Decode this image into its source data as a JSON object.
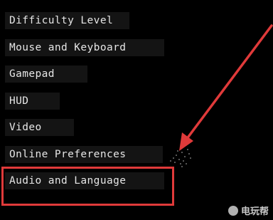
{
  "menu": {
    "items": [
      {
        "label": "Difficulty Level"
      },
      {
        "label": "Mouse and Keyboard"
      },
      {
        "label": "Gamepad"
      },
      {
        "label": "HUD"
      },
      {
        "label": "Video"
      },
      {
        "label": "Online Preferences"
      },
      {
        "label": "Audio and Language"
      }
    ]
  },
  "annotation": {
    "highlighted_item": "Audio and Language",
    "color": "#e03a3a"
  },
  "watermark": {
    "text": "电玩帮"
  }
}
